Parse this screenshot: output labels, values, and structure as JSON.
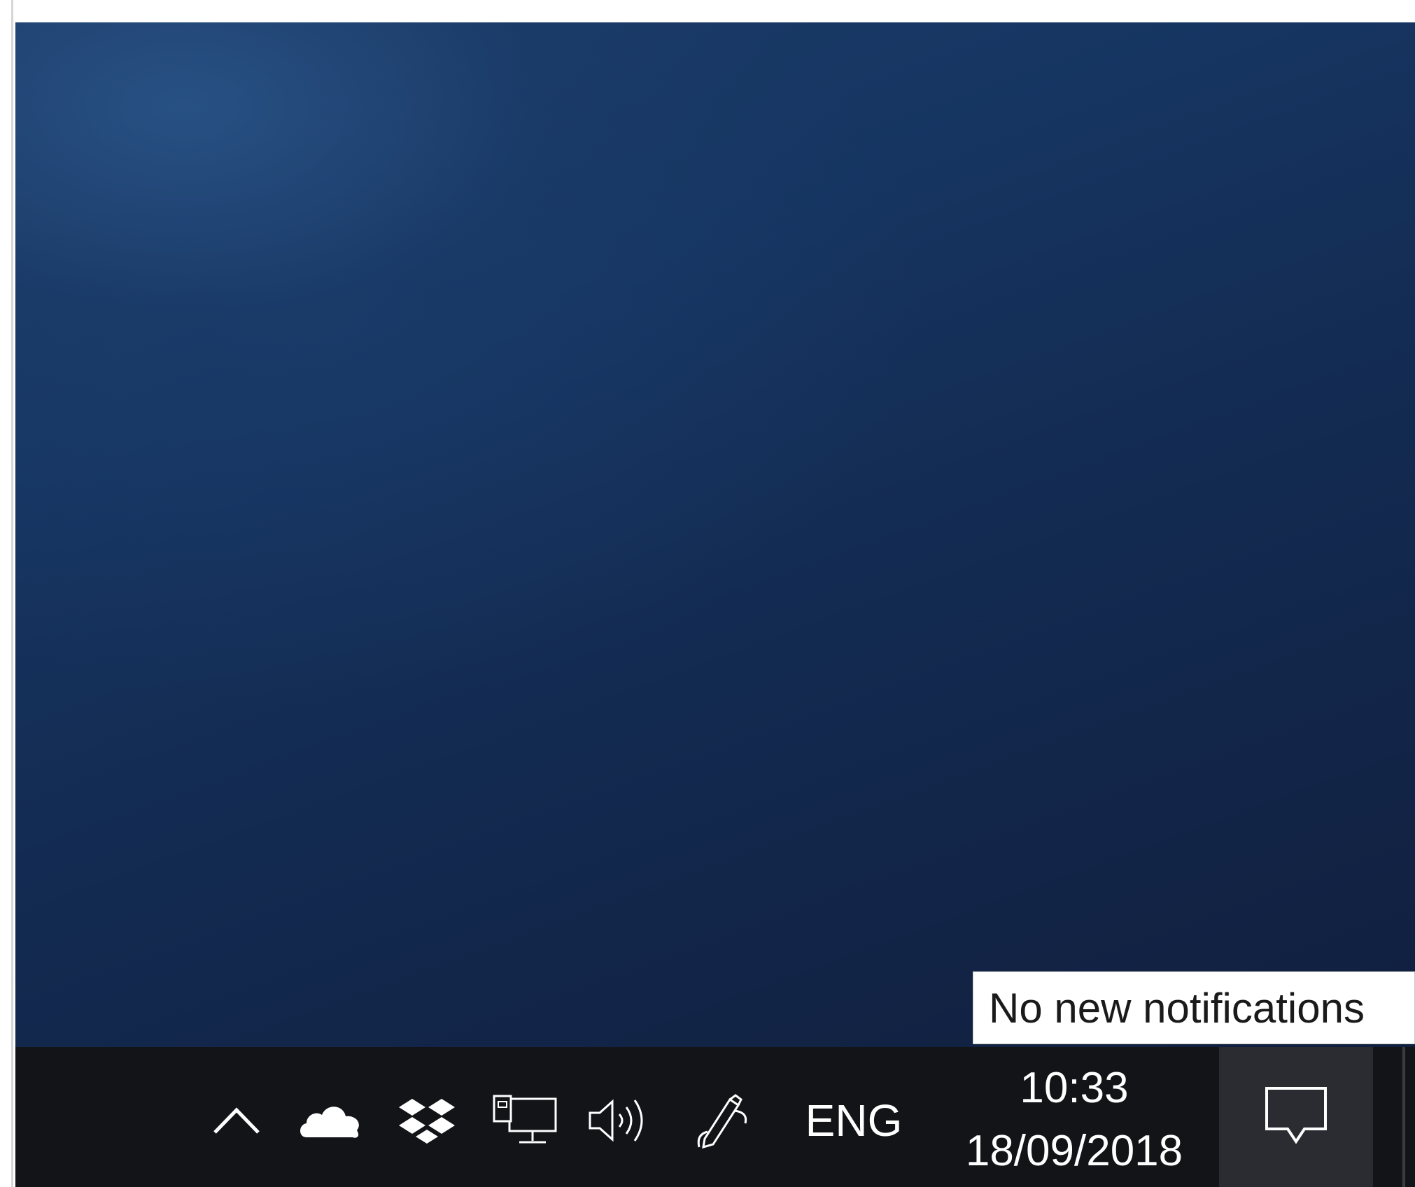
{
  "tooltip": {
    "text": "No new notifications"
  },
  "tray": {
    "icons": [
      "chevron-up-icon",
      "onedrive-cloud-icon",
      "dropbox-icon",
      "network-icon",
      "volume-icon",
      "pen-workspace-icon"
    ],
    "language": "ENG",
    "time": "10:33",
    "date": "18/09/2018",
    "action_center_icon": "notification-icon"
  },
  "colors": {
    "taskbar": "#121418",
    "desktop": "#132b52",
    "action_center_bg": "#2a2c31"
  }
}
